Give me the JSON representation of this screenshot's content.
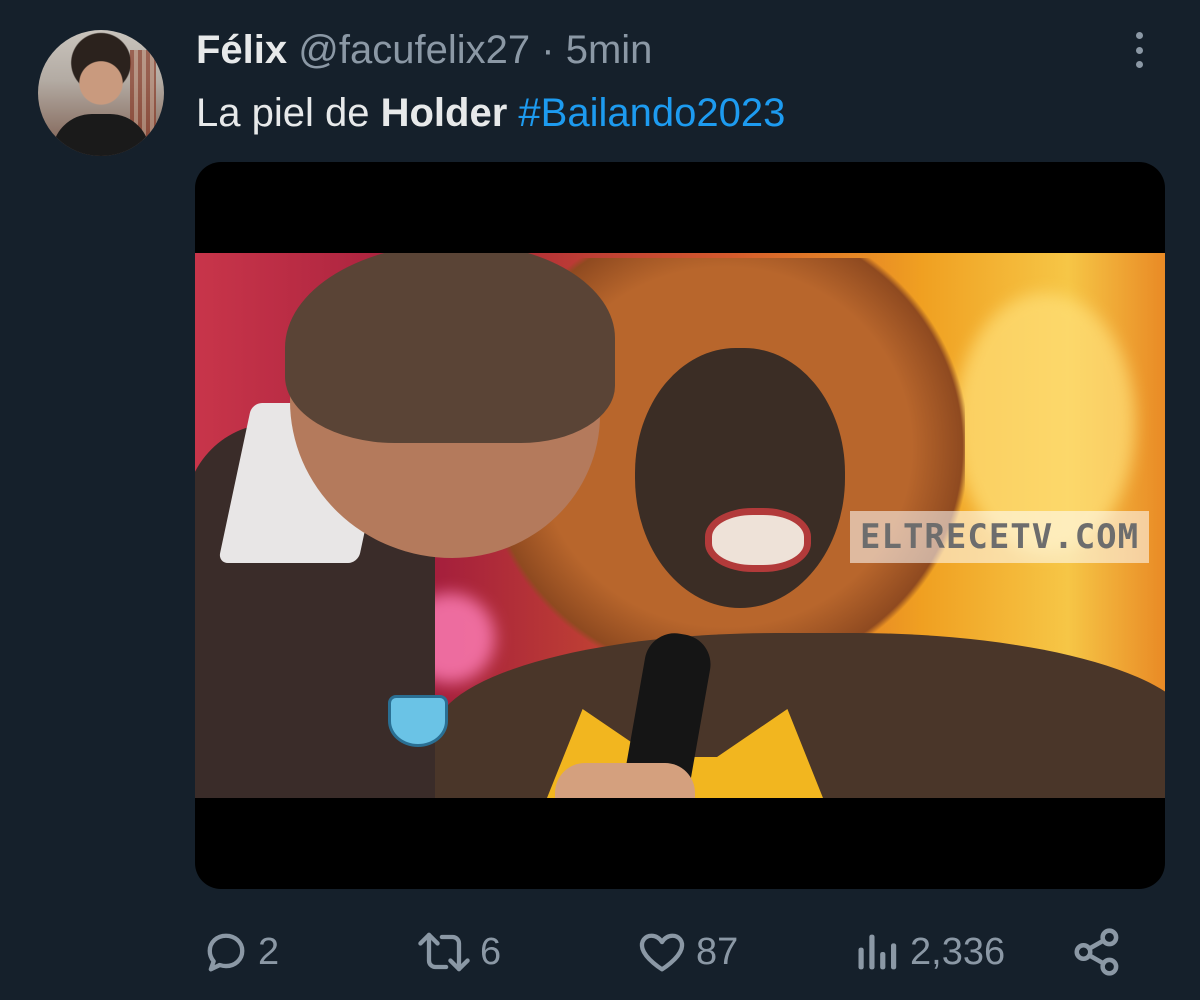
{
  "tweet": {
    "display_name": "Félix",
    "handle": "@facufelix27",
    "separator": "·",
    "time": "5min",
    "text_plain": "La piel de ",
    "text_bold": "Holder",
    "hashtag": "#Bailando2023"
  },
  "media": {
    "watermark": "ELTRECETV.COM"
  },
  "actions": {
    "replies": "2",
    "retweets": "6",
    "likes": "87",
    "views": "2,336"
  },
  "colors": {
    "background": "#15202b",
    "primary_text": "#e7e9ea",
    "secondary_text": "#8b98a5",
    "link": "#1d9bf0"
  },
  "icons": [
    "more-icon",
    "reply-icon",
    "retweet-icon",
    "like-icon",
    "views-icon",
    "share-icon"
  ]
}
